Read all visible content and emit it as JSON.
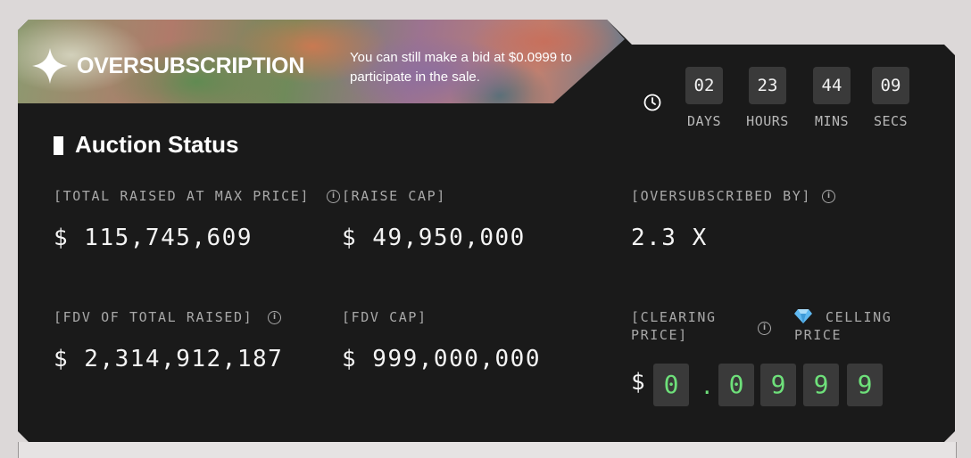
{
  "banner": {
    "title": "OVERSUBSCRIPTION",
    "subtitle": "You can still make a bid at $0.0999 to participate in the sale."
  },
  "countdown": [
    {
      "value": "02",
      "label": "DAYS"
    },
    {
      "value": "23",
      "label": "HOURS"
    },
    {
      "value": "44",
      "label": "MINS"
    },
    {
      "value": "09",
      "label": "SECS"
    }
  ],
  "section": {
    "title": "Auction Status"
  },
  "stats": {
    "total_raised_label": "[TOTAL RAISED AT MAX PRICE]",
    "total_raised_value": "$ 115,745,609",
    "raise_cap_label": "[RAISE CAP]",
    "raise_cap_value": "$ 49,950,000",
    "oversubscribed_label": "[OVERSUBSCRIBED BY]",
    "oversubscribed_value": "2.3 X",
    "fdv_total_label": "[FDV OF TOTAL RAISED]",
    "fdv_total_value": "$ 2,314,912,187",
    "fdv_cap_label": "[FDV CAP]",
    "fdv_cap_value": "$ 999,000,000",
    "clearing_price_label_1": "[CLEARING",
    "clearing_price_label_2": "PRICE]",
    "ceiling_price_label_1": "CELLING",
    "ceiling_price_label_2": "PRICE"
  },
  "price": {
    "currency": "$",
    "digits": [
      "0",
      "0",
      "9",
      "9",
      "9"
    ],
    "separator": "."
  },
  "icons": {
    "logo": "sparkle-star-icon",
    "clock": "clock-icon",
    "info": "info-icon",
    "gem": "diamond-gem-icon"
  },
  "colors": {
    "accent_green": "#6ee07a",
    "card_bg": "#1a1a1a",
    "gem": "#5fb8f0"
  }
}
